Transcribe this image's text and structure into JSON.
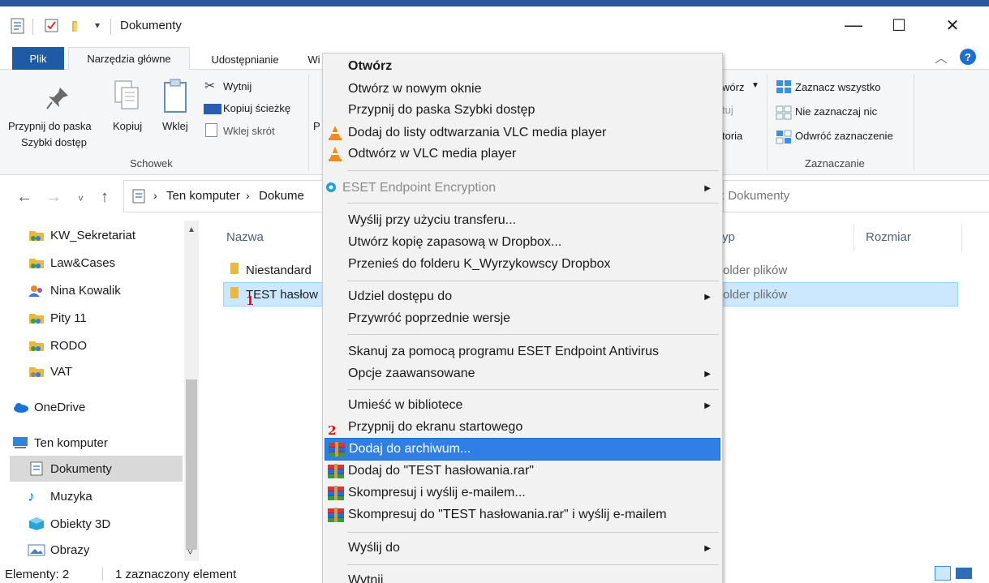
{
  "window": {
    "title": "Dokumenty",
    "minimize": "—",
    "maximize": "☐",
    "close": "✕"
  },
  "ribbon_tabs": {
    "plik": "Plik",
    "main": "Narzędzia główne",
    "share": "Udostępnianie",
    "view": "Wi"
  },
  "ribbon": {
    "pin_line1": "Przypnij do paska",
    "pin_line2": "Szybki dostęp",
    "copy": "Kopiuj",
    "paste": "Wklej",
    "cut": "Wytnij",
    "copy_path": "Kopiuj ścieżkę",
    "paste_shortcut": "Wklej skrót",
    "p_cut": "P",
    "group_clipboard": "Schowek",
    "open_frag": "wórz",
    "edit_frag": "tuj",
    "history_frag": "toria",
    "select_all": "Zaznacz wszystko",
    "select_none": "Nie zaznaczaj nic",
    "invert_selection": "Odwróć zaznaczenie",
    "group_selection": "Zaznaczanie"
  },
  "address": {
    "crumb_pc": "Ten komputer",
    "crumb_docs": "Dokume",
    "search_placeholder": ": Dokumenty"
  },
  "nav": [
    {
      "label": "KW_Sekretariat",
      "icon": "shared-folder-icon"
    },
    {
      "label": "Law&Cases",
      "icon": "shared-folder-icon"
    },
    {
      "label": "Nina Kowalik",
      "icon": "user-folder-icon"
    },
    {
      "label": "Pity 11",
      "icon": "shared-folder-icon"
    },
    {
      "label": "RODO",
      "icon": "shared-folder-icon"
    },
    {
      "label": "VAT",
      "icon": "shared-folder-icon"
    },
    {
      "label": "OneDrive",
      "icon": "cloud-icon"
    },
    {
      "label": "Ten komputer",
      "icon": "computer-icon"
    },
    {
      "label": "Dokumenty",
      "icon": "documents-icon"
    },
    {
      "label": "Muzyka",
      "icon": "music-icon"
    },
    {
      "label": "Obiekty 3D",
      "icon": "cube-icon"
    },
    {
      "label": "Obrazy",
      "icon": "pictures-icon"
    }
  ],
  "filelist": {
    "col_name": "Nazwa",
    "col_type": "yp",
    "col_size": "Rozmiar",
    "rows": [
      {
        "name": "Niestandard",
        "type": "older plików"
      },
      {
        "name": "TEST hasłow",
        "type": "older plików"
      }
    ],
    "marker_1": "1"
  },
  "status": {
    "items": "Elementy: 2",
    "selected": "1 zaznaczony element"
  },
  "menu": {
    "open": "Otwórz",
    "open_new_window": "Otwórz w nowym oknie",
    "pin_quick": "Przypnij do paska Szybki dostęp",
    "vlc_add": "Dodaj do listy odtwarzania VLC media player",
    "vlc_play": "Odtwórz w VLC media player",
    "eset_enc": "ESET Endpoint Encryption",
    "send_transfer": "Wyślij przy użyciu transferu...",
    "dropbox_backup": "Utwórz kopię zapasową w Dropbox...",
    "dropbox_move": "Przenieś do folderu K_Wyrzykowscy Dropbox",
    "share_with": "Udziel dostępu do",
    "restore_prev": "Przywróć poprzednie wersje",
    "eset_scan": "Skanuj za pomocą programu ESET Endpoint Antivirus",
    "advanced": "Opcje zaawansowane",
    "library": "Umieść w bibliotece",
    "pin_start": "Przypnij do ekranu startowego",
    "add_archive": "Dodaj do archiwum...",
    "add_rar": "Dodaj do \"TEST hasłowania.rar\"",
    "compress_email": "Skompresuj i wyślij e-mailem...",
    "compress_rar_email": "Skompresuj do \"TEST hasłowania.rar\" i wyślij e-mailem",
    "send_to": "Wyślij do",
    "cut": "Wytnij",
    "marker_2": "2"
  },
  "colors": {
    "accent": "#1f5aa6",
    "highlight": "#2f7fe6",
    "selection": "#cce8ff"
  }
}
